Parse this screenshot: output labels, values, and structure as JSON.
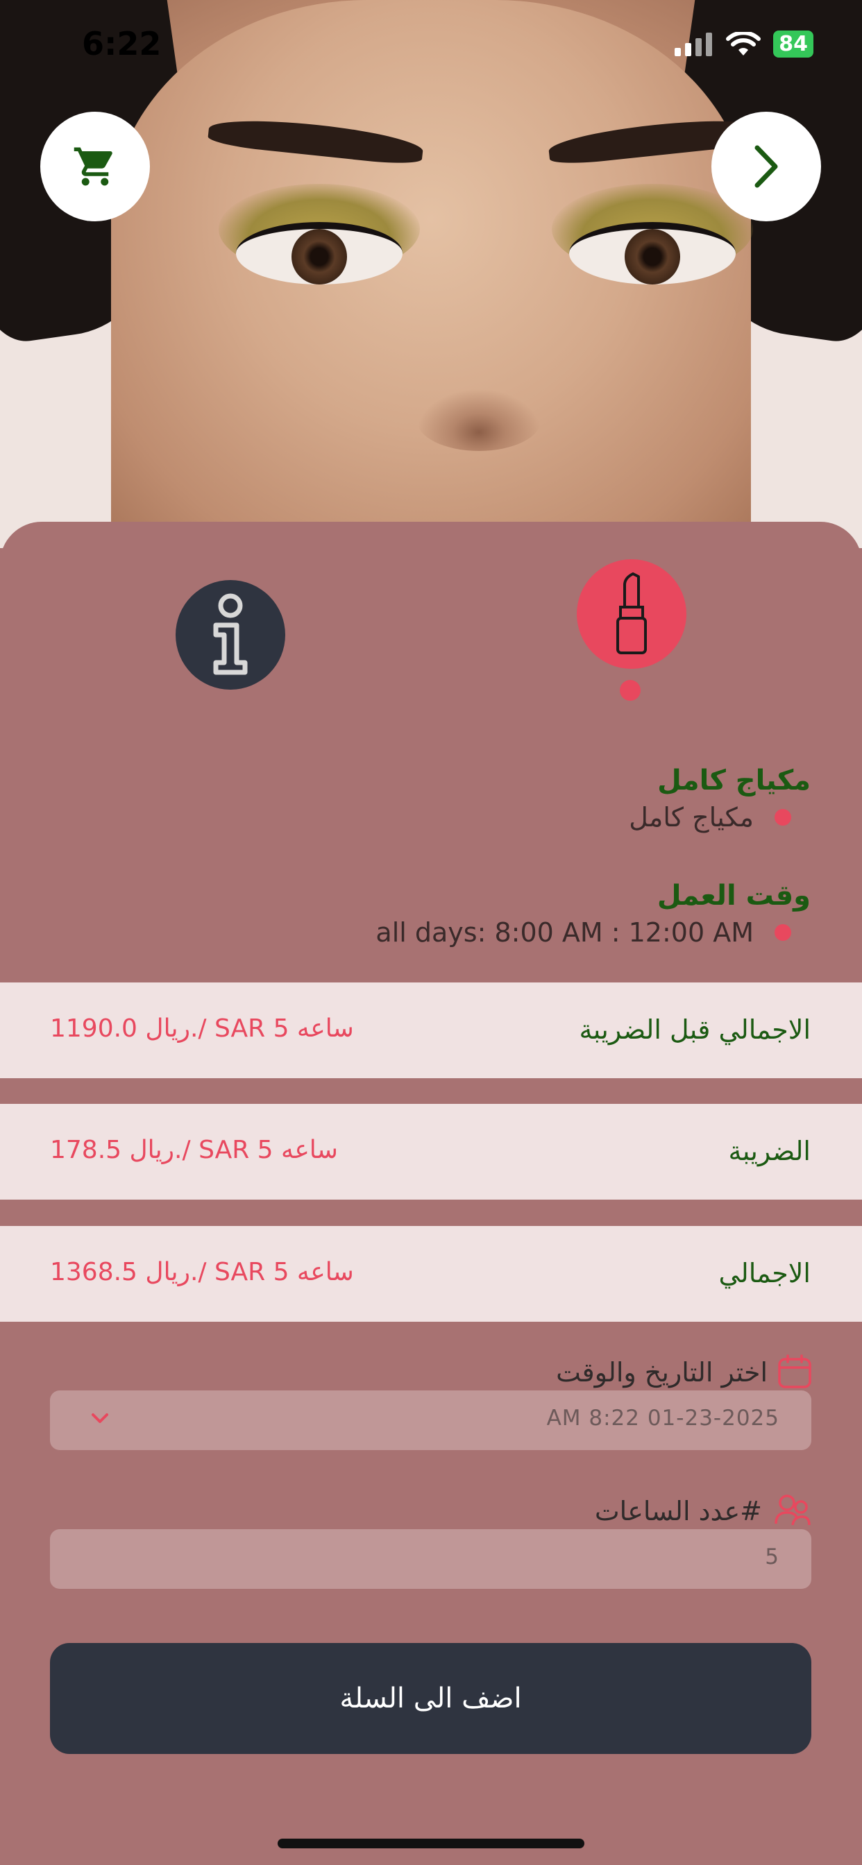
{
  "status_bar": {
    "time": "6:22",
    "battery": "84"
  },
  "header": {
    "cart_icon": "cart-icon",
    "next_icon": "chevron-right-icon"
  },
  "tabs": [
    {
      "name": "info",
      "icon": "info-icon"
    },
    {
      "name": "makeup",
      "icon": "lipstick-icon",
      "active": true
    }
  ],
  "service": {
    "title": "مكياج كامل",
    "value": "مكياج كامل"
  },
  "work_time": {
    "title": "وقت العمل",
    "value": "all days: 8:00 AM : 12:00 AM"
  },
  "summary": [
    {
      "label": "الاجمالي قبل الضريبة",
      "value": "1190.0 ريال./ SAR 5 ساعه"
    },
    {
      "label": "الضريبة",
      "value": "178.5 ريال./ SAR 5 ساعه"
    },
    {
      "label": "الاجمالي",
      "value": "1368.5 ريال./ SAR 5 ساعه"
    }
  ],
  "datetime": {
    "label": "اختر التاريخ والوقت",
    "value": "AM 8:22 01-23-2025"
  },
  "hours": {
    "label": "#عدد الساعات",
    "value": "5"
  },
  "add_to_cart_label": "اضف الى السلة",
  "colors": {
    "accent": "#e8485e",
    "dark": "#2f3440",
    "sheet": "#a87272",
    "green": "#1b5a12"
  }
}
